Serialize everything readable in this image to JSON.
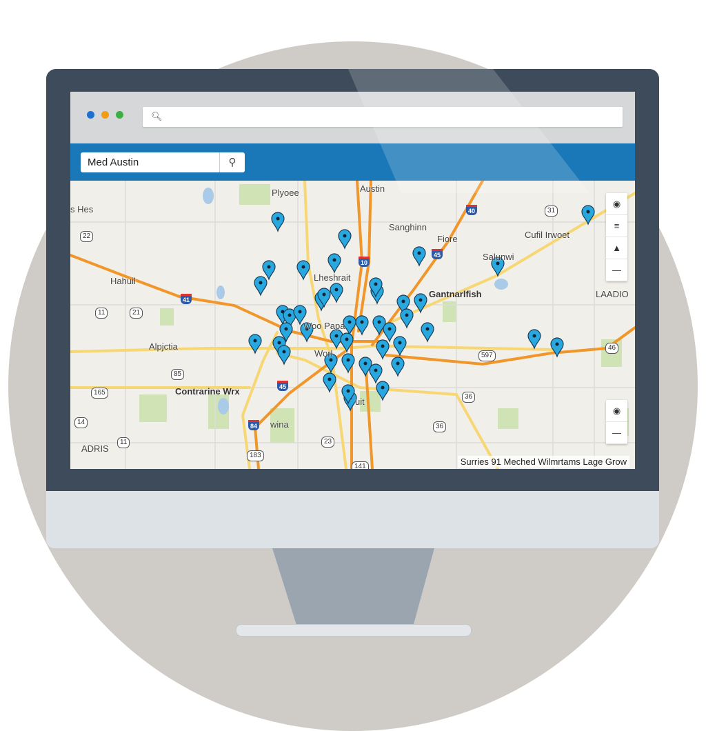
{
  "browser": {
    "window_dots": [
      "#1f6fd1",
      "#f39c12",
      "#3cb043"
    ],
    "url_bar": {
      "icon": "search-icon",
      "value": ""
    }
  },
  "header": {
    "color": "#1a78b8",
    "search": {
      "value": "Med Austin",
      "button_icon": "search-icon"
    }
  },
  "map": {
    "labels": {
      "plyoee": "Plyoee",
      "austin": "Austin",
      "hes": "s Hes",
      "sanghinn": "Sanghinn",
      "fiore": "Fiore",
      "cufil": "Cufil Irwoet",
      "salunwi": "Salunwi",
      "hahuil": "Hahuil",
      "lheshrait": "Lheshrait",
      "gantnarlfish": "Gantnarlfish",
      "laadio": "LAADIO",
      "woopapa": "Woo Papa",
      "alpjctia": "Alpjctia",
      "worl": "Worl",
      "contrarine": "Contrarine Wrx",
      "wina": "wina",
      "adris": "ADRIS",
      "uit": "uit"
    },
    "shields": [
      "22",
      "11",
      "21",
      "85",
      "165",
      "14",
      "11",
      "23",
      "183",
      "141",
      "31",
      "597",
      "36",
      "36",
      "46"
    ],
    "interstates": [
      "40",
      "10",
      "45",
      "41",
      "45",
      "84"
    ],
    "pin_color": "#29a8e0",
    "highway_color": "#f0962a",
    "road_color": "#f6d774",
    "controls": {
      "top": [
        "locate-icon",
        "layers-icon",
        "street-view-icon",
        "zoom-out-icon"
      ],
      "bottom": [
        "camera-icon",
        "zoom-out-icon"
      ]
    },
    "status": "Surries 91 Meched  Wilmrtams Lage Grow"
  }
}
